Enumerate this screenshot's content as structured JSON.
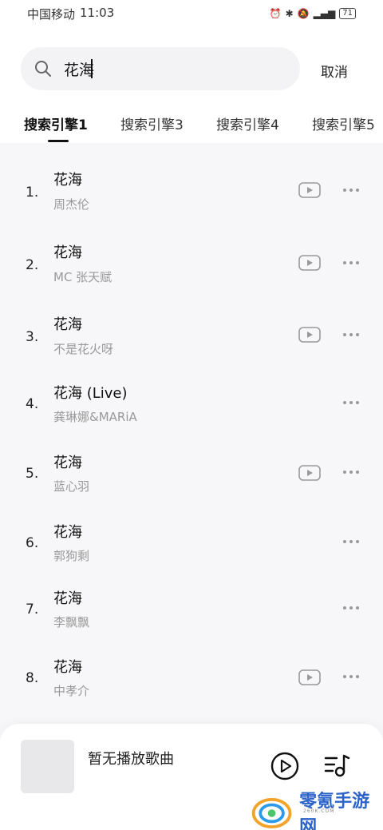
{
  "status_bar": {
    "carrier": "中国移动",
    "time": "11:03",
    "battery": "71"
  },
  "search": {
    "query": "花海",
    "cancel_label": "取消"
  },
  "tabs": [
    {
      "label": "搜索引擎1",
      "active": true
    },
    {
      "label": "搜索引擎3",
      "active": false
    },
    {
      "label": "搜索引擎4",
      "active": false
    },
    {
      "label": "搜索引擎5",
      "active": false
    }
  ],
  "results": [
    {
      "index": "1.",
      "title": "花海",
      "artist": "周杰伦",
      "has_video": true
    },
    {
      "index": "2.",
      "title": "花海",
      "artist": "MC 张天赋",
      "has_video": true
    },
    {
      "index": "3.",
      "title": "花海",
      "artist": "不是花火呀",
      "has_video": true
    },
    {
      "index": "4.",
      "title": "花海 (Live)",
      "artist": "龚琳娜&MARiA",
      "has_video": false
    },
    {
      "index": "5.",
      "title": "花海",
      "artist": "蓝心羽",
      "has_video": true
    },
    {
      "index": "6.",
      "title": "花海",
      "artist": "郭狗剩",
      "has_video": false
    },
    {
      "index": "7.",
      "title": "花海",
      "artist": "李飘飘",
      "has_video": false
    },
    {
      "index": "8.",
      "title": "花海",
      "artist": "中孝介",
      "has_video": true
    }
  ],
  "player": {
    "now_playing": "暂无播放歌曲"
  },
  "watermark": {
    "text": "零氪手游网",
    "sub": "260K.COM"
  },
  "colors": {
    "background": "#f7f7f9",
    "icon_gray": "#999999",
    "watermark_blue": "#2b63c8"
  }
}
